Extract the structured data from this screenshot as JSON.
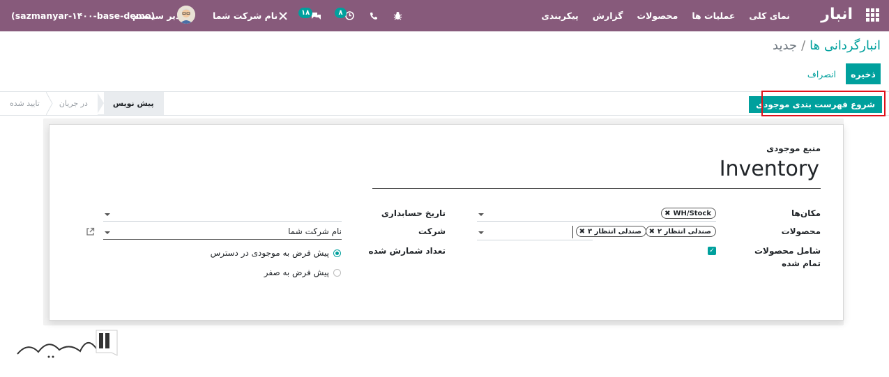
{
  "navbar": {
    "brand": "انبار",
    "menu": [
      "نمای کلی",
      "عملیات ها",
      "محصولات",
      "گزارش",
      "پیکربندی"
    ],
    "db_label": "(sazmanyar-۱۴۰۰-base-demo)",
    "user_name": "مدیر سیستم",
    "company_name": "نام شرکت شما",
    "messages_badge": "۱۸",
    "activities_badge": "۸",
    "icons": {
      "apps": "apps-grid-icon",
      "bug": "bug-icon",
      "phone": "phone-icon",
      "activity": "clock-icon",
      "chat": "chat-icon",
      "tools": "tools-icon"
    },
    "accent": "#875a7b"
  },
  "breadcrumb": {
    "parent": "انبارگردانی ها",
    "separator": "/",
    "current": "جدید"
  },
  "actions": {
    "save": "ذخیره",
    "discard": "انصراف"
  },
  "statusbar": {
    "start_button": "شروع فهرست بندی موجودی",
    "stages": [
      "تایید شده",
      "در جریان",
      "پیش نویس"
    ],
    "current_stage": "پیش نویس"
  },
  "form": {
    "source_label": "منبع موجودی",
    "source_value": "Inventory",
    "locations_label": "مکان‌ها",
    "locations_tags": [
      "WH/Stock"
    ],
    "products_label": "محصولات",
    "products_tags": [
      "صندلی انتظار ۲",
      "صندلی انتظار ۳"
    ],
    "include_exhausted_label": "شامل محصولات تمام شده",
    "include_exhausted": true,
    "accounting_date_label": "تاریخ حسابداری",
    "accounting_date_value": "",
    "company_label": "شرکت",
    "company_value": "نام شرکت شما",
    "counted_qty_label": "تعداد شمارش شده",
    "counted_options": [
      "پیش فرض به موجودی در دسترس",
      "پیش فرض به صفر"
    ],
    "counted_selected": "پیش فرض به موجودی در دسترس"
  },
  "colors": {
    "primary": "#00a09d",
    "highlight": "#e0101a"
  }
}
